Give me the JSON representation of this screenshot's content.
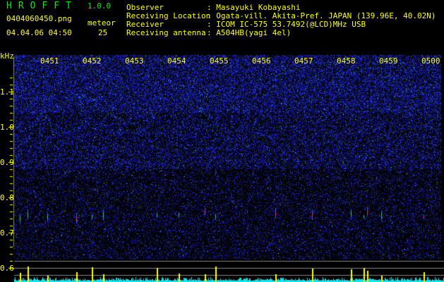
{
  "header": {
    "app_title": "HROFFT",
    "version": "1.0.0",
    "filename": "0404060450.png",
    "datetime": "04.04.06 04:50",
    "meteor_label": "meteor",
    "meteor_count": "25",
    "info": [
      {
        "label": "Observer",
        "value": ": Masayuki Kobayashi"
      },
      {
        "label": "Receiving Location",
        "value": ": Ogata-vill. Akita-Pref. JAPAN (139.96E, 40.02N)"
      },
      {
        "label": "Receiver",
        "value": ": ICOM IC-575 53.7492(@LCD)MHz USB"
      },
      {
        "label": "Receiving antenna",
        "value": ": A504HB(yagi 4el)"
      }
    ]
  },
  "spectrogram": {
    "freq_unit": "kHz",
    "freq_labels": [
      "1.1",
      "1.0",
      "0.9",
      "0.8",
      "0.7",
      "0.6"
    ],
    "time_labels": [
      "0451",
      "0452",
      "0453",
      "0454",
      "0455",
      "0456",
      "0457",
      "0458",
      "0459",
      "0500"
    ],
    "echoes": [
      {
        "min": 0.13,
        "khz": 0.74
      },
      {
        "min": 0.32,
        "khz": 0.75
      },
      {
        "min": 0.78,
        "khz": 0.745
      },
      {
        "min": 1.47,
        "khz": 0.74
      },
      {
        "min": 1.83,
        "khz": 0.745
      },
      {
        "min": 2.1,
        "khz": 0.75
      },
      {
        "min": 3.37,
        "khz": 0.75
      },
      {
        "min": 3.88,
        "khz": 0.75
      },
      {
        "min": 4.5,
        "khz": 0.76
      },
      {
        "min": 4.75,
        "khz": 0.745
      },
      {
        "min": 6.17,
        "khz": 0.755
      },
      {
        "min": 7.03,
        "khz": 0.75
      },
      {
        "min": 7.95,
        "khz": 0.755
      },
      {
        "min": 8.25,
        "khz": 0.745
      },
      {
        "min": 8.33,
        "khz": 0.76
      },
      {
        "min": 8.67,
        "khz": 0.75
      },
      {
        "min": 9.67,
        "khz": 0.745
      }
    ],
    "colors": {
      "noise": "#1a2cd0",
      "echo_hot": "#ff2060",
      "echo_warm": "#20e060",
      "panel_bars": "#00e8f0",
      "spikes": "#ffff00",
      "grid": "#888888"
    }
  }
}
